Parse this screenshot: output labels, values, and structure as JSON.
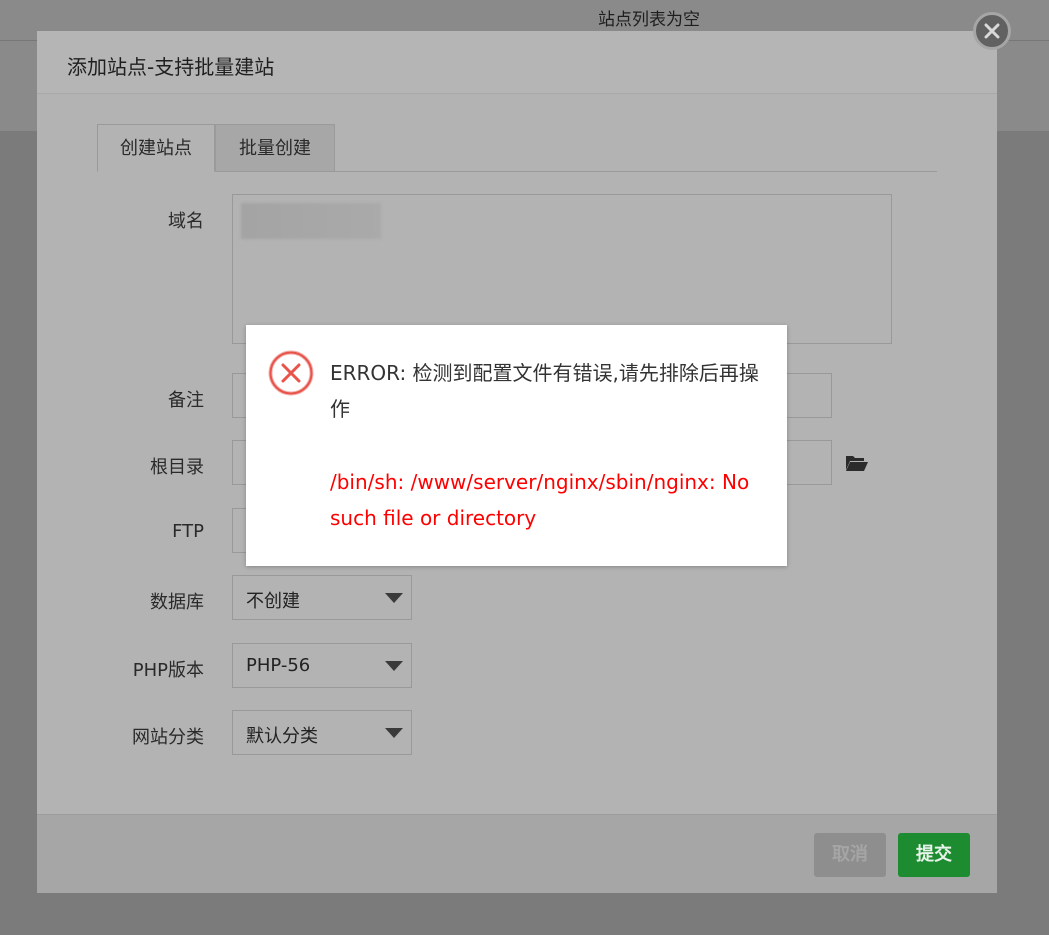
{
  "background": {
    "empty_text": "站点列表为空"
  },
  "dialog": {
    "title": "添加站点-支持批量建站",
    "tabs": [
      {
        "label": "创建站点",
        "active": true
      },
      {
        "label": "批量创建",
        "active": false
      }
    ],
    "form": {
      "domain_label": "域名",
      "domain_value": "",
      "remark_label": "备注",
      "root_label": "根目录",
      "ftp_label": "FTP",
      "database_label": "数据库",
      "database_value": "不创建",
      "php_label": "PHP版本",
      "php_value": "PHP-56",
      "category_label": "网站分类",
      "category_value": "默认分类"
    },
    "footer": {
      "cancel_label": "取消",
      "submit_label": "提交"
    }
  },
  "error_popup": {
    "message": "ERROR: 检测到配置文件有错误,请先排除后再操作",
    "detail": "/bin/sh: /www/server/nginx/sbin/nginx: No such file or directory"
  },
  "colors": {
    "submit": "#1d8c31",
    "error_text": "#ff0000",
    "error_icon": "#e8534a"
  },
  "icons": {
    "close": "close-icon",
    "folder": "folder-open-icon",
    "error": "error-circle-x-icon",
    "dropdown": "chevron-down-icon"
  }
}
